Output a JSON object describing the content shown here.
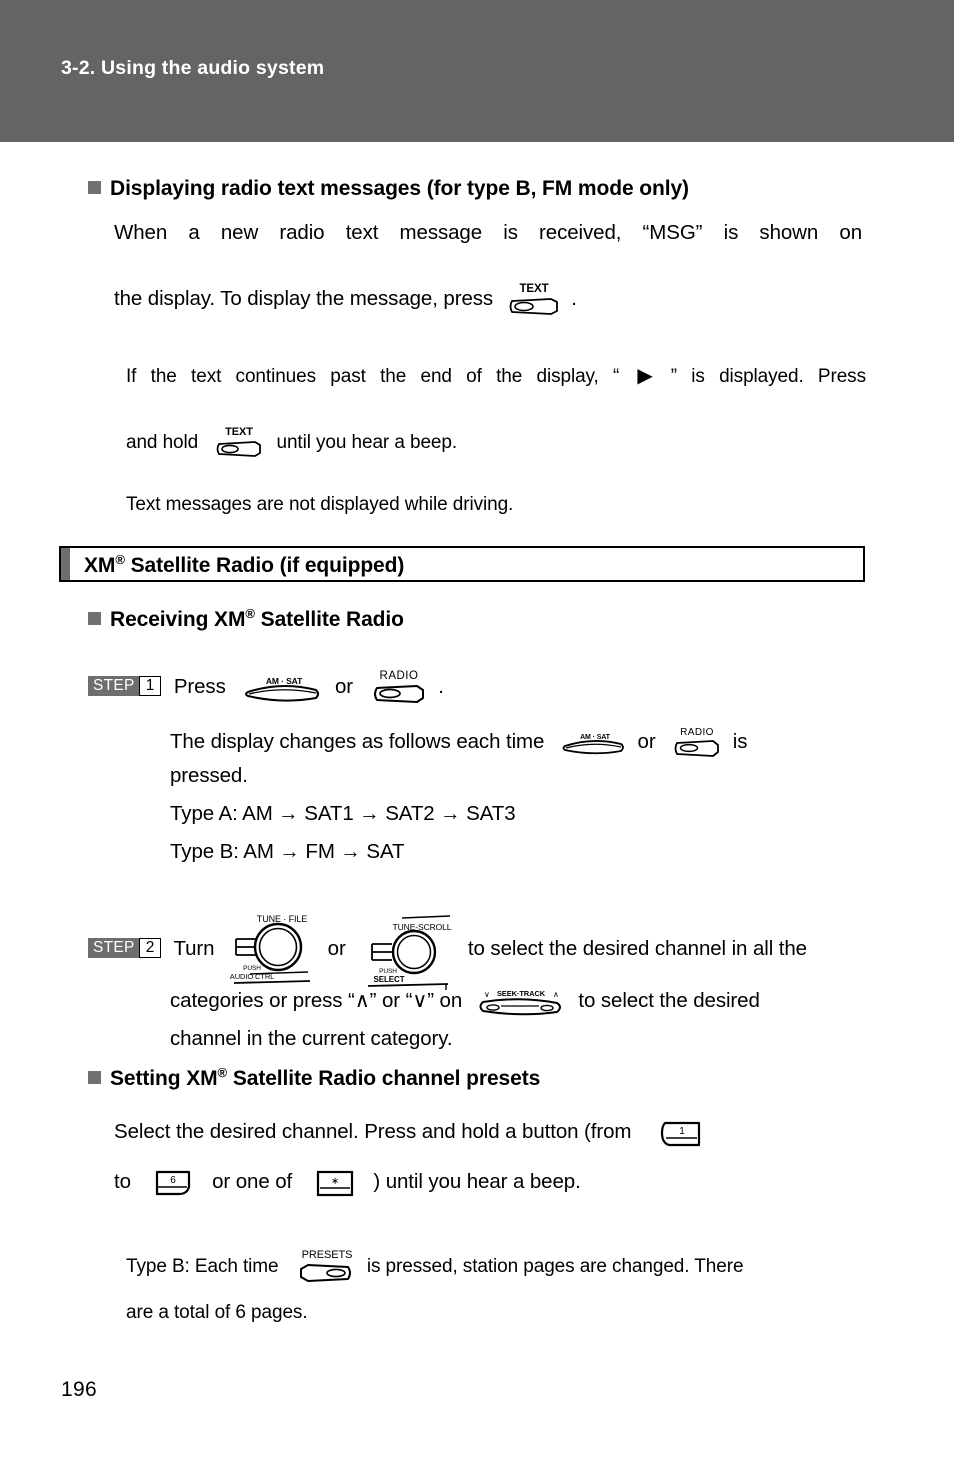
{
  "header": {
    "chapter_title": "3-2. Using the audio system"
  },
  "sections": {
    "radio_text": {
      "heading": "Displaying radio text messages (for type B, FM mode only)",
      "paragraph_line1": "When a new radio text message is received, “MSG” is shown on",
      "paragraph_line2_before": "the display. To display the message, press",
      "paragraph_line2_after": ".",
      "note1_before": "If the text continues past the end of the display, “",
      "note1_after": "” is displayed. Press",
      "note2_before": "and hold",
      "note2_after": "until you hear a beep.",
      "note3": "Text messages are not displayed while driving."
    },
    "xm_title_box": {
      "title_pre": "XM",
      "title_reg": "®",
      "title_post": " Satellite Radio (if equipped)"
    },
    "receiving": {
      "heading_pre": "Receiving XM",
      "heading_reg": "®",
      "heading_post": " Satellite Radio",
      "step1": {
        "badge_word": "STEP",
        "badge_number": "1",
        "text_before": "Press",
        "text_mid": "or",
        "text_after": "."
      },
      "body_line1_a": "The display changes as follows each time",
      "body_line1_b": "or",
      "body_line1_c": "is",
      "body_line2": "pressed.",
      "type_a": "Type A: AM → SAT1 → SAT2 → SAT3",
      "type_b": "Type B: AM → FM → SAT",
      "step2": {
        "badge_word": "STEP",
        "badge_number": "2",
        "text_before": "Turn",
        "text_mid": "or",
        "text_after": "to select the desired channel in all the",
        "line2_a": "categories or press “∧” or “∨” on",
        "line2_b": "to select the desired",
        "line3": "channel in the current category."
      }
    },
    "presets": {
      "heading_pre": "Setting XM",
      "heading_reg": "®",
      "heading_post": " Satellite Radio channel presets",
      "line1": "Select the desired channel. Press and hold a button (from",
      "line2_a": "to",
      "line2_b": "or one of",
      "line2_c": ") until you hear a beep.",
      "note_a": "Type B: Each time",
      "note_b": "is pressed, station pages are changed. There",
      "note_c": "are a total of 6 pages."
    }
  },
  "icons": {
    "text_button_label": "TEXT",
    "radio_button_label": "RADIO",
    "am_sat_button_label": "AM · SAT",
    "tune_file_knob_label": "TUNE · FILE",
    "tune_file_knob_push": "PUSH",
    "tune_file_knob_sub": "AUDIO CTRL",
    "tune_scroll_knob_label": "TUNE·SCROLL",
    "tune_scroll_knob_push": "PUSH",
    "tune_scroll_knob_sub": "SELECT",
    "seek_track_button_label": "SEEK·TRACK",
    "seek_track_down": "∨",
    "seek_track_up": "∧",
    "presets_button_label": "PRESETS",
    "preset_1_label": "1",
    "preset_6_label": "6",
    "preset_star_label": "∗",
    "display_arrow": "▶"
  },
  "footer": {
    "page_number": "196"
  },
  "colors": {
    "header_band": "#646464",
    "bullet_gray": "#717171",
    "step_badge_gray": "#6e6e6e",
    "text_black": "#000000",
    "page_white": "#ffffff"
  }
}
